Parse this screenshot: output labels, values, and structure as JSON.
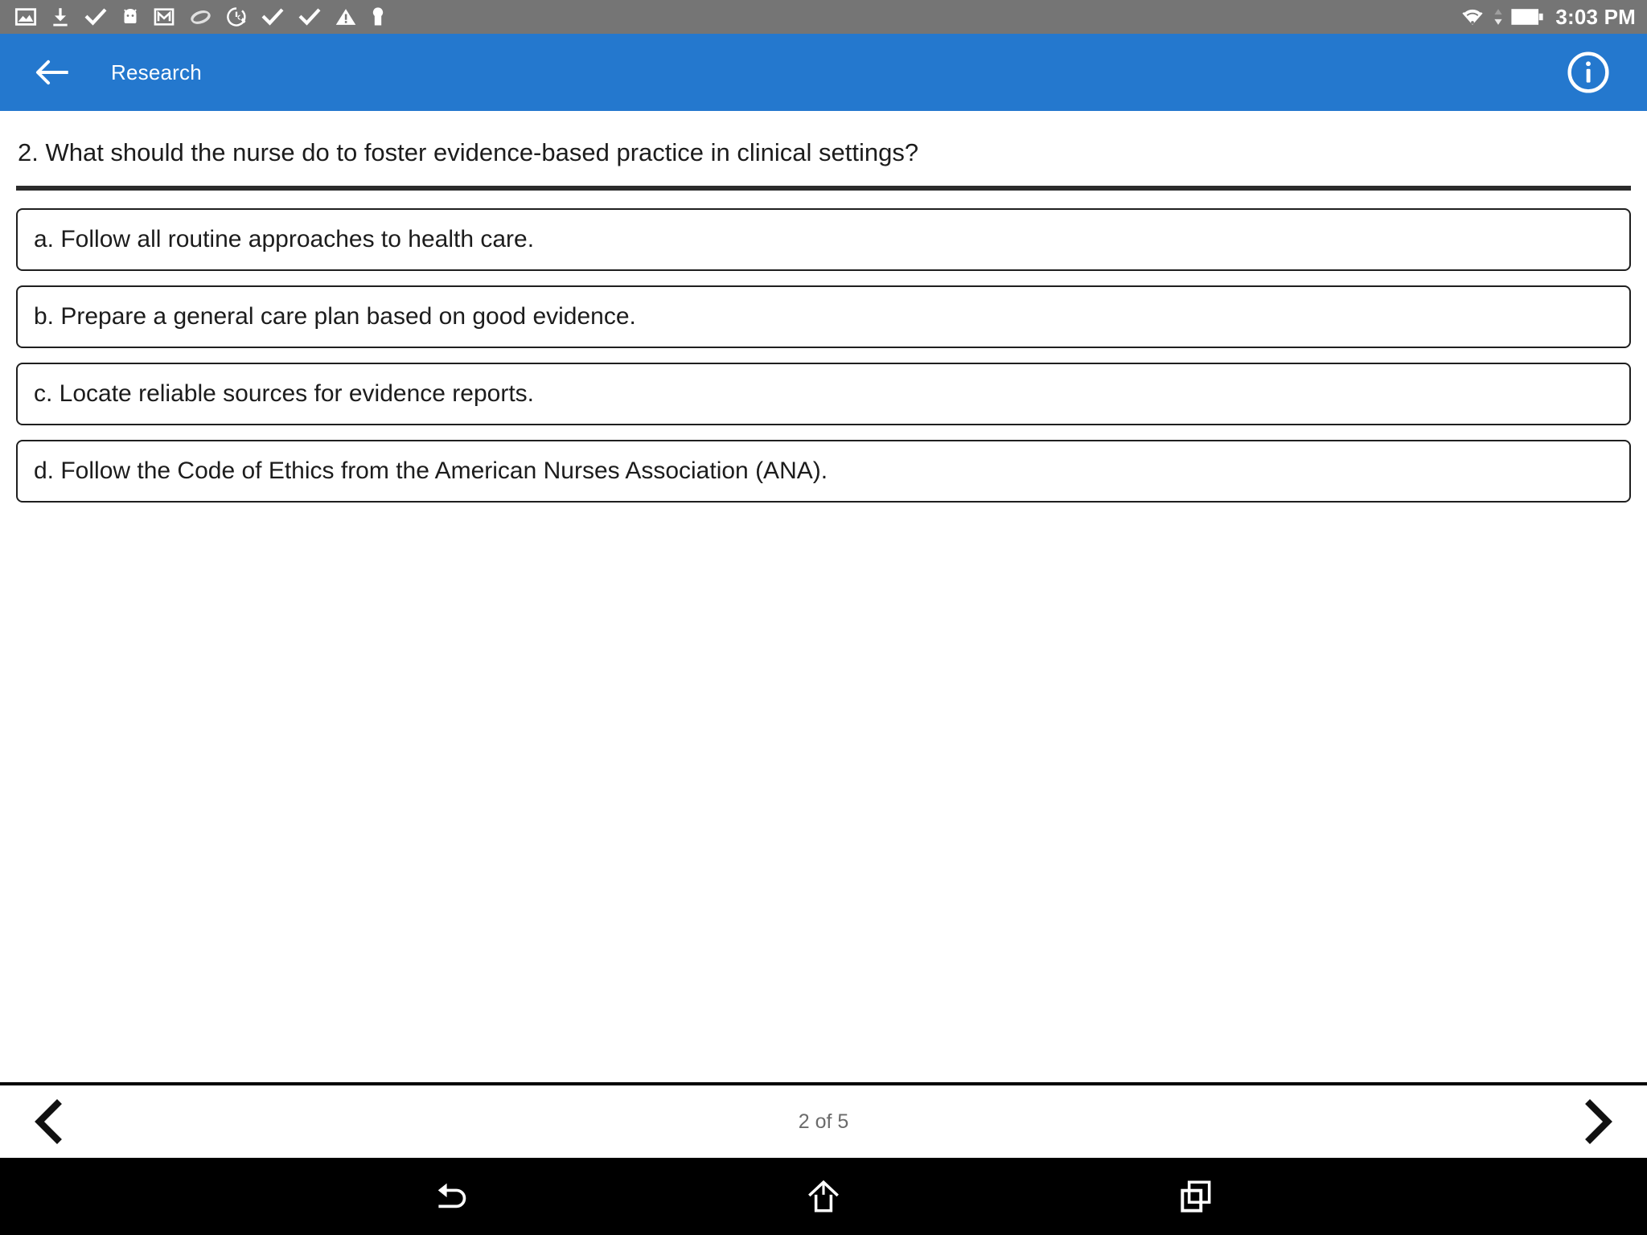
{
  "status_bar": {
    "background_color": "#757575",
    "left_icons": [
      {
        "name": "photo-icon",
        "label": "photo"
      },
      {
        "name": "download-icon",
        "label": "download"
      },
      {
        "name": "checkmark-icon",
        "label": "check"
      },
      {
        "name": "android-robot-icon",
        "label": "android"
      },
      {
        "name": "gmail-icon",
        "label": "gmail"
      },
      {
        "name": "ellipse-icon",
        "label": "ellipse"
      },
      {
        "name": "tune-up-icon",
        "label": "tune up"
      },
      {
        "name": "checkmark-icon-2",
        "label": "check"
      },
      {
        "name": "checkmark-icon-3",
        "label": "check"
      },
      {
        "name": "warning-triangle-icon",
        "label": "warning"
      },
      {
        "name": "keyhole-icon",
        "label": "keyhole"
      }
    ],
    "right_icons": [
      {
        "name": "wifi-icon",
        "label": "wifi"
      },
      {
        "name": "data-transfer-arrows-icon",
        "label": "data transfer"
      },
      {
        "name": "battery-icon",
        "label": "battery"
      }
    ],
    "clock": "3:03 PM"
  },
  "app_bar": {
    "background_color": "#2478ce",
    "back_label": "Back",
    "title": "Research",
    "info_label": "Information"
  },
  "question": {
    "number": "2",
    "text": "2. What should the nurse do to foster evidence-based practice in clinical settings?",
    "options": [
      {
        "id": "a",
        "label": "a. Follow all routine approaches to health care."
      },
      {
        "id": "b",
        "label": "b. Prepare a general care plan based on good evidence."
      },
      {
        "id": "c",
        "label": "c. Locate reliable sources for evidence reports."
      },
      {
        "id": "d",
        "label": "d. Follow the Code of Ethics from the American Nurses Association (ANA)."
      }
    ]
  },
  "pager": {
    "prev_label": "Previous",
    "count_text": "2 of 5",
    "next_label": "Next"
  },
  "nav_bar": {
    "background_color": "#000000",
    "buttons": [
      {
        "name": "android-back-button",
        "label": "Back"
      },
      {
        "name": "android-home-button",
        "label": "Home"
      },
      {
        "name": "android-recents-button",
        "label": "Recent apps"
      }
    ]
  }
}
